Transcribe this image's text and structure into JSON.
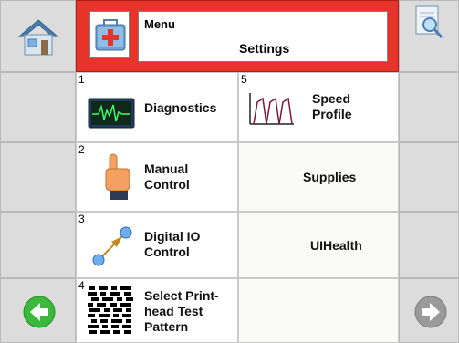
{
  "header": {
    "menu_label": "Menu",
    "page_title": "Settings"
  },
  "buttons": [
    {
      "number": "1",
      "label": "Diagnostics",
      "icon": "oscilloscope-icon"
    },
    {
      "number": "5",
      "label": "Speed Profile",
      "icon": "speed-profile-icon"
    },
    {
      "number": "2",
      "label": "Manual Control",
      "icon": "pointing-hand-icon"
    },
    {
      "number": "",
      "label": "Supplies"
    },
    {
      "number": "3",
      "label": "Digital IO Control",
      "icon": "digital-io-icon"
    },
    {
      "number": "",
      "label": "UIHealth"
    },
    {
      "number": "4",
      "label": "Select Print-head Test Pattern",
      "icon": "test-pattern-icon"
    }
  ],
  "nav": {
    "home": "home-icon",
    "search": "search-document-icon",
    "back": "back-arrow-icon",
    "forward": "forward-arrow-icon"
  },
  "colors": {
    "header_red": "#e8332a",
    "back_green": "#3cb83c",
    "forward_disabled": "#9a9a9a"
  }
}
